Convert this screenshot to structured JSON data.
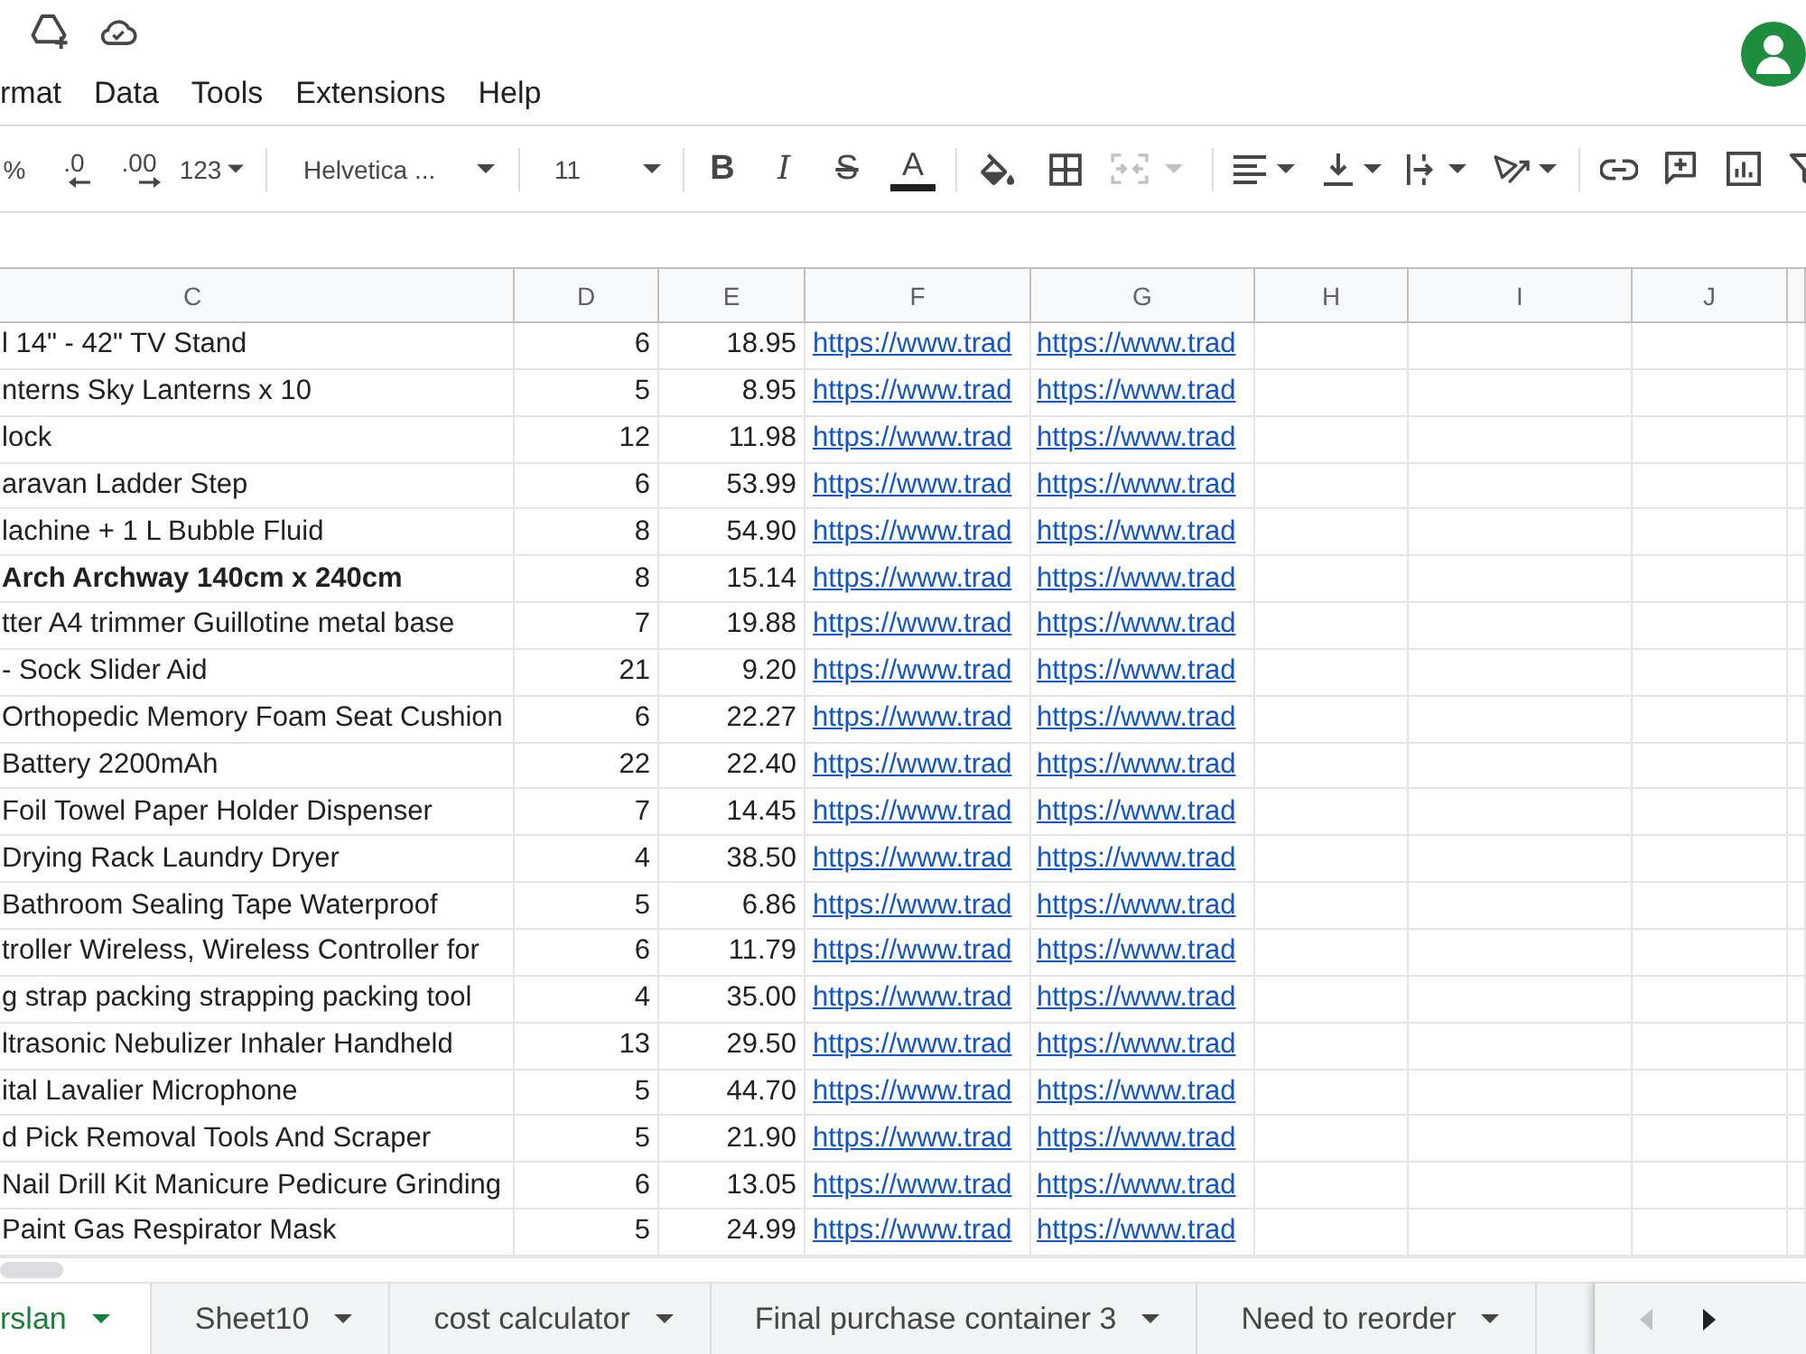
{
  "menu": [
    "rmat",
    "Data",
    "Tools",
    "Extensions",
    "Help"
  ],
  "toolbar": {
    "percent": "%",
    "decrease_decimal": ".0",
    "increase_decimal": ".00",
    "number_format": "123",
    "font_family": "Helvetica ...",
    "font_size": "11",
    "bold": "B",
    "italic": "I",
    "strikethrough": "S",
    "text_color": "A",
    "merge_disabled": true
  },
  "sheet": {
    "columns": [
      "C",
      "D",
      "E",
      "F",
      "G",
      "H",
      "I",
      "J"
    ],
    "rows": [
      {
        "c": "l 14\" - 42\" TV Stand",
        "d": "6",
        "e": "18.95",
        "f": "https://www.trad",
        "g": "https://www.trad",
        "bold": false
      },
      {
        "c": "nterns Sky Lanterns x 10",
        "d": "5",
        "e": "8.95",
        "f": "https://www.trad",
        "g": "https://www.trad",
        "bold": false
      },
      {
        "c": "lock",
        "d": "12",
        "e": "11.98",
        "f": "https://www.trad",
        "g": "https://www.trad",
        "bold": false
      },
      {
        "c": "aravan Ladder Step",
        "d": "6",
        "e": "53.99",
        "f": "https://www.trad",
        "g": "https://www.trad",
        "bold": false
      },
      {
        "c": "lachine + 1 L Bubble Fluid",
        "d": "8",
        "e": "54.90",
        "f": "https://www.trad",
        "g": "https://www.trad",
        "bold": false
      },
      {
        "c": "Arch Archway 140cm x 240cm",
        "d": "8",
        "e": "15.14",
        "f": "https://www.trad",
        "g": "https://www.trad",
        "bold": true
      },
      {
        "c": "tter A4 trimmer Guillotine metal base",
        "d": "7",
        "e": "19.88",
        "f": "https://www.trad",
        "g": "https://www.trad",
        "bold": false
      },
      {
        "c": "- Sock Slider Aid",
        "d": "21",
        "e": "9.20",
        "f": "https://www.trad",
        "g": "https://www.trad",
        "bold": false
      },
      {
        "c": "Orthopedic Memory Foam Seat Cushion",
        "d": "6",
        "e": "22.27",
        "f": "https://www.trad",
        "g": "https://www.trad",
        "bold": false
      },
      {
        "c": "Battery 2200mAh",
        "d": "22",
        "e": "22.40",
        "f": "https://www.trad",
        "g": "https://www.trad",
        "bold": false
      },
      {
        "c": "Foil Towel Paper Holder Dispenser",
        "d": "7",
        "e": "14.45",
        "f": "https://www.trad",
        "g": "https://www.trad",
        "bold": false
      },
      {
        "c": "Drying Rack Laundry Dryer",
        "d": "4",
        "e": "38.50",
        "f": "https://www.trad",
        "g": "https://www.trad",
        "bold": false
      },
      {
        "c": "Bathroom Sealing Tape Waterproof",
        "d": "5",
        "e": "6.86",
        "f": "https://www.trad",
        "g": "https://www.trad",
        "bold": false
      },
      {
        "c": "troller Wireless, Wireless Controller for",
        "d": "6",
        "e": "11.79",
        "f": "https://www.trad",
        "g": "https://www.trad",
        "bold": false
      },
      {
        "c": "g strap packing strapping packing tool",
        "d": "4",
        "e": "35.00",
        "f": "https://www.trad",
        "g": "https://www.trad",
        "bold": false
      },
      {
        "c": "ltrasonic Nebulizer Inhaler Handheld",
        "d": "13",
        "e": "29.50",
        "f": "https://www.trad",
        "g": "https://www.trad",
        "bold": false
      },
      {
        "c": "ital Lavalier Microphone",
        "d": "5",
        "e": "44.70",
        "f": "https://www.trad",
        "g": "https://www.trad",
        "bold": false
      },
      {
        "c": "d Pick Removal Tools And Scraper",
        "d": "5",
        "e": "21.90",
        "f": "https://www.trad",
        "g": "https://www.trad",
        "bold": false
      },
      {
        "c": "Nail Drill Kit Manicure Pedicure Grinding",
        "d": "6",
        "e": "13.05",
        "f": "https://www.trad",
        "g": "https://www.trad",
        "bold": false
      },
      {
        "c": "Paint Gas Respirator Mask",
        "d": "5",
        "e": "24.99",
        "f": "https://www.trad",
        "g": "https://www.trad",
        "bold": false
      }
    ]
  },
  "sheet_tabs": {
    "tabs": [
      {
        "label": "rslan",
        "selected": true
      },
      {
        "label": "Sheet10",
        "selected": false
      },
      {
        "label": "cost calculator",
        "selected": false
      },
      {
        "label": "Final purchase container 3",
        "selected": false
      },
      {
        "label": "Need to reorder",
        "selected": false
      }
    ],
    "scroll_left_disabled": true,
    "scroll_right_disabled": false
  }
}
